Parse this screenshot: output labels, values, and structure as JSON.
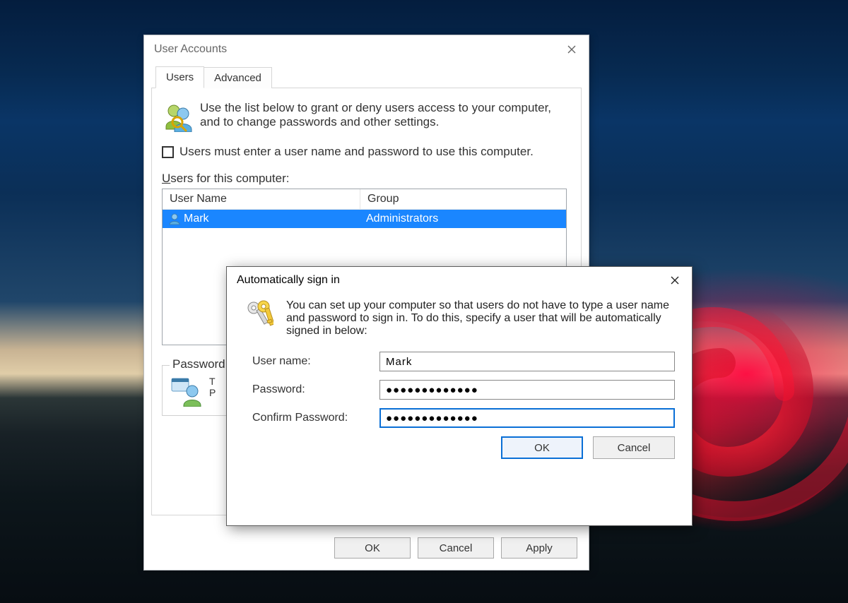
{
  "parent_dialog": {
    "title": "User Accounts",
    "tabs": {
      "users": "Users",
      "advanced": "Advanced"
    },
    "intro": "Use the list below to grant or deny users access to your computer, and to change passwords and other settings.",
    "checkbox_label": "Users must enter a user name and password to use this computer.",
    "list_label_prefix": "U",
    "list_label_rest": "sers for this computer:",
    "columns": {
      "username": "User Name",
      "group": "Group"
    },
    "rows": [
      {
        "username": "Mark",
        "group": "Administrators"
      }
    ],
    "pwd_group_legend": "Password f",
    "pwd_group_line1": "T",
    "pwd_group_line2": "P",
    "buttons": {
      "ok": "OK",
      "cancel": "Cancel",
      "apply": "Apply"
    }
  },
  "child_dialog": {
    "title": "Automatically sign in",
    "intro": "You can set up your computer so that users do not have to type a user name and password to sign in. To do this, specify a user that will be automatically signed in below:",
    "labels": {
      "username": "User name:",
      "password": "Password:",
      "confirm": "Confirm Password:"
    },
    "values": {
      "username": "Mark",
      "password": "●●●●●●●●●●●●●",
      "confirm": "●●●●●●●●●●●●●"
    },
    "buttons": {
      "ok": "OK",
      "cancel": "Cancel"
    }
  }
}
